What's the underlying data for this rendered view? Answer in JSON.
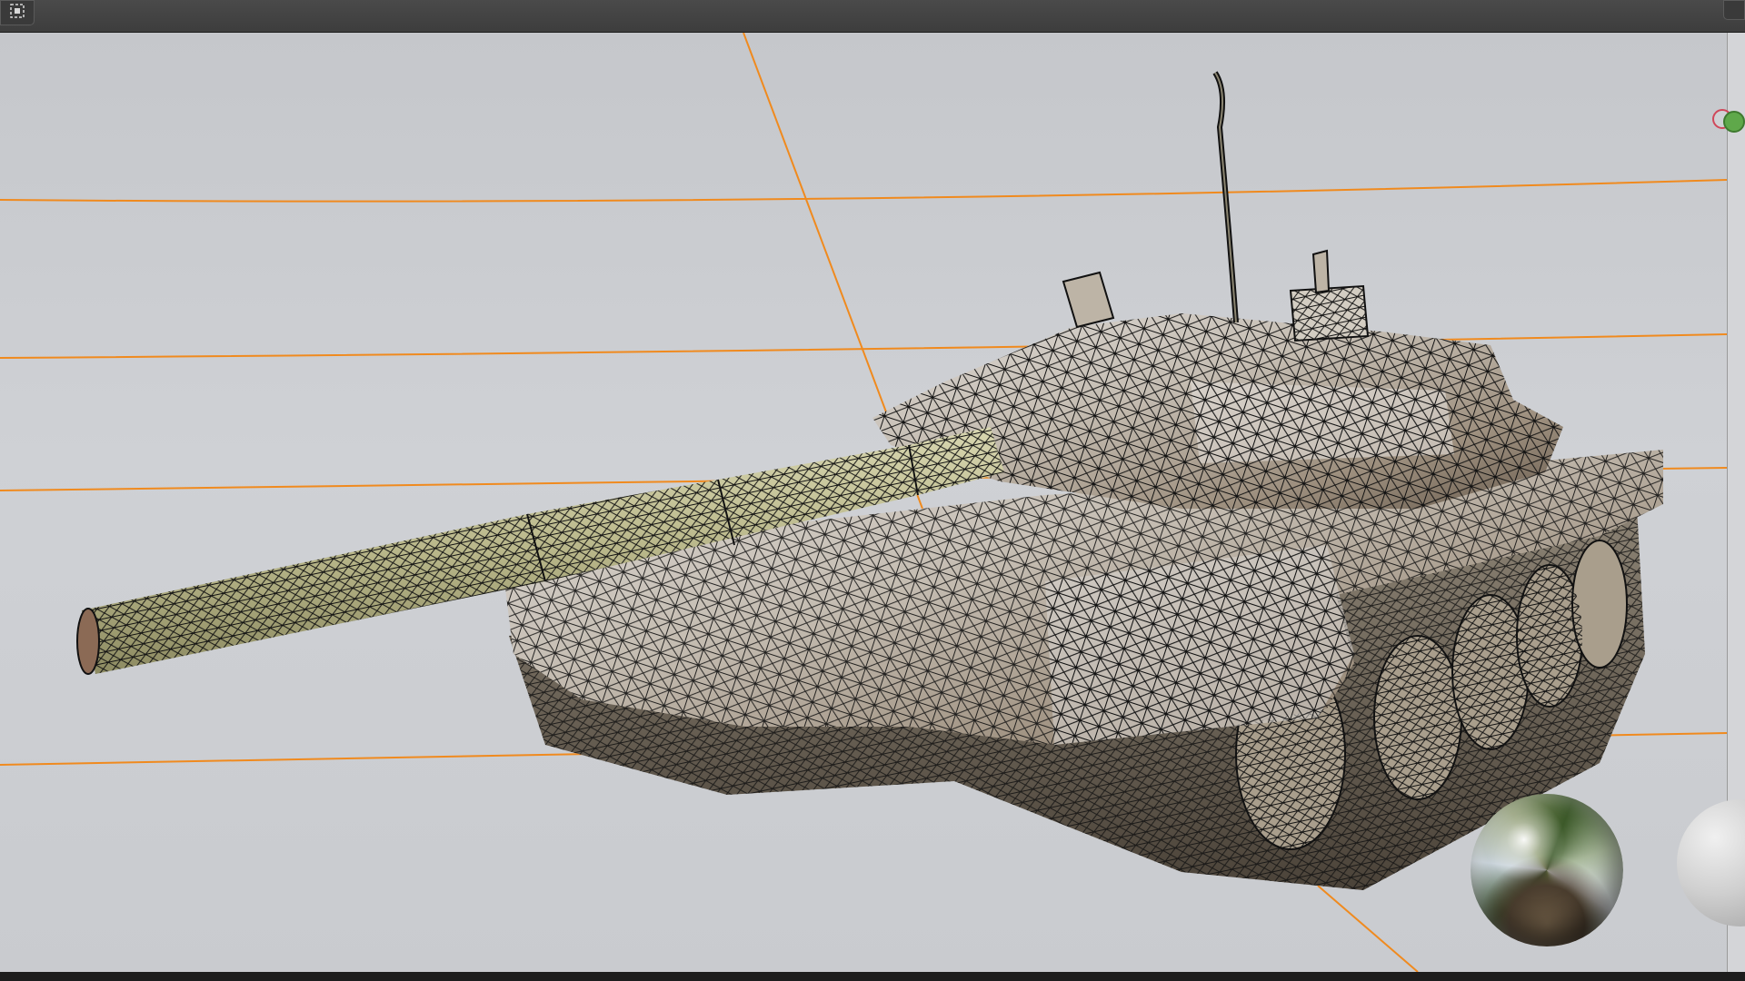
{
  "window": {
    "top_left_icon": "select-box-icon",
    "top_right_icon": "corner-widget-icon"
  },
  "viewport": {
    "background_color": "#c9cbcf",
    "grid_line_color": "#f08a1e",
    "wire_color": "#111111",
    "model": "tank-mesh-wireframe",
    "gizmo": {
      "x_axis_color": "#d0485a",
      "y_axis_color": "#5fa84a"
    },
    "overlays": [
      "hdri-preview-sphere",
      "matcap-sphere"
    ]
  }
}
